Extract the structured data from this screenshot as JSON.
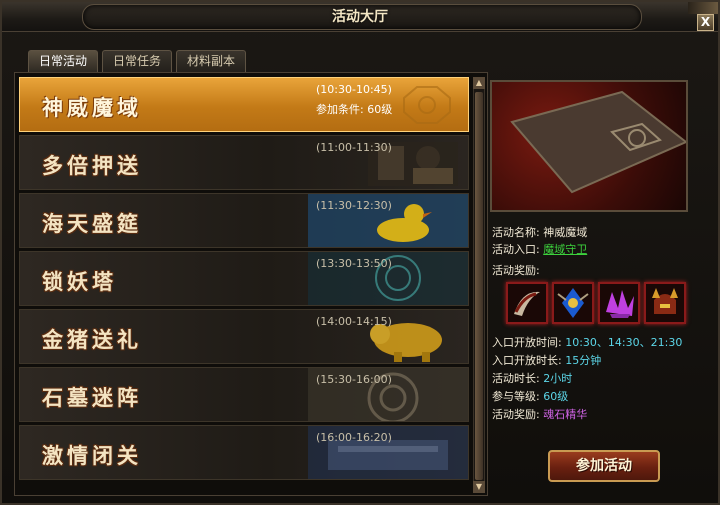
{
  "window": {
    "title": "活动大厅",
    "close_label": "X"
  },
  "tabs": [
    {
      "label": "日常活动",
      "active": true
    },
    {
      "label": "日常任务",
      "active": false
    },
    {
      "label": "材料副本",
      "active": false
    }
  ],
  "activities": [
    {
      "name": "神威魔域",
      "time": "(10:30-10:45)",
      "condition": "参加条件: 60级",
      "selected": true
    },
    {
      "name": "多倍押送",
      "time": "(11:00-11:30)"
    },
    {
      "name": "海天盛筵",
      "time": "(11:30-12:30)"
    },
    {
      "name": "锁妖塔",
      "time": "(13:30-13:50)"
    },
    {
      "name": "金猪送礼",
      "time": "(14:00-14:15)"
    },
    {
      "name": "石墓迷阵",
      "time": "(15:30-16:00)"
    },
    {
      "name": "激情闭关",
      "time": "(16:00-16:20)"
    }
  ],
  "detail": {
    "name_label": "活动名称:",
    "name_value": "神威魔域",
    "entry_label": "活动入口:",
    "entry_value": "魔域守卫",
    "reward_label": "活动奖励:",
    "open_time_label": "入口开放时间:",
    "open_time_value": "10:30、14:30、21:30",
    "open_duration_label": "入口开放时长:",
    "open_duration_value": "15分钟",
    "duration_label": "活动时长:",
    "duration_value": "2小时",
    "level_label": "参与等级:",
    "level_value": "60级",
    "reward2_label": "活动奖励:",
    "reward2_value": "魂石精华",
    "join_label": "参加活动"
  },
  "reward_items": [
    "horn-weapon-icon",
    "blue-gem-amulet-icon",
    "purple-crystal-icon",
    "demon-helmet-icon"
  ],
  "colors": {
    "link": "#3dd23d",
    "cyan": "#5cd6e8",
    "purple": "#d064e6",
    "selected_row": "#d88a24"
  }
}
